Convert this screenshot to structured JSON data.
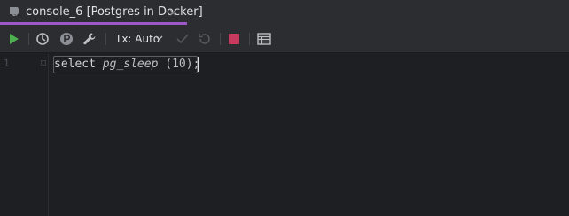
{
  "tab": {
    "label": "console_6 [Postgres in Docker]",
    "close_glyph": "×",
    "icon": "postgres-console-icon",
    "underline_color": "#9d57c9"
  },
  "toolbar": {
    "run_icon": "run-icon",
    "history_icon": "history-icon",
    "pin_icon": "pin-icon",
    "settings_icon": "wrench-icon",
    "tx_label": "Tx: Auto",
    "commit_icon": "commit-check-icon",
    "rollback_icon": "rollback-icon",
    "stop_icon": "stop-icon",
    "table_icon": "table-icon",
    "run_color": "#4caf50",
    "stop_color": "#c93b5e"
  },
  "editor": {
    "line_number": "1",
    "code": {
      "keyword": "select",
      "function": "pg_sleep",
      "args": " (10)",
      "terminator": ";"
    }
  }
}
